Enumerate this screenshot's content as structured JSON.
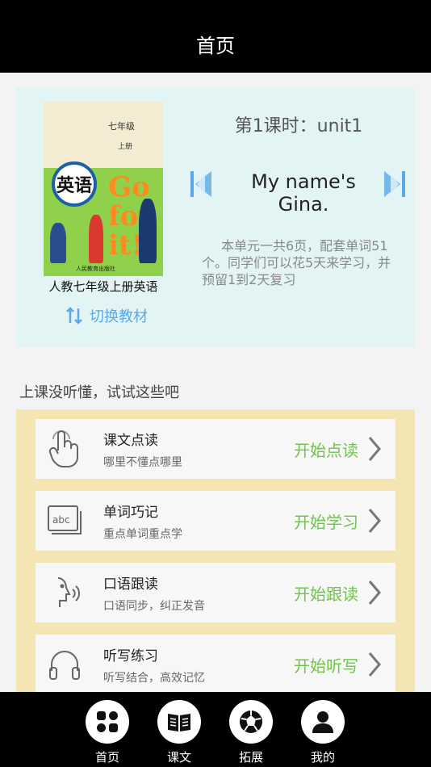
{
  "header": {
    "title": "首页"
  },
  "book": {
    "cover": {
      "grade": "七年级",
      "term": "上册",
      "badge": "英语",
      "go_text": "Go for it!",
      "publisher": "人民教育出版社"
    },
    "title": "人教七年级上册英语",
    "switch_label": "切换教材"
  },
  "lesson": {
    "title": "第1课时：unit1",
    "unit_name": "My name's Gina.",
    "description": "本单元一共6页，配套单词51个。同学们可以花5天来学习，并预留1到2天复习"
  },
  "section": {
    "title": "上课没听懂，试试这些吧"
  },
  "activities": [
    {
      "name": "课文点读",
      "subtitle": "哪里不懂点哪里",
      "action": "开始点读",
      "icon": "hand-pointer-icon"
    },
    {
      "name": "单词巧记",
      "subtitle": "重点单词重点学",
      "action": "开始学习",
      "icon": "abc-card-icon"
    },
    {
      "name": "口语跟读",
      "subtitle": "口语同步，纠正发音",
      "action": "开始跟读",
      "icon": "speaking-head-icon"
    },
    {
      "name": "听写练习",
      "subtitle": "听写结合，高效记忆",
      "action": "开始听写",
      "icon": "headphones-icon"
    }
  ],
  "tabs": [
    {
      "label": "首页",
      "icon": "grid-icon"
    },
    {
      "label": "课文",
      "icon": "book-icon"
    },
    {
      "label": "拓展",
      "icon": "ball-icon"
    },
    {
      "label": "我的",
      "icon": "user-icon"
    }
  ],
  "colors": {
    "accent_blue": "#5aa7ea",
    "accent_green": "#6fc44b",
    "panel_blue": "#e3f4f4",
    "panel_yellow": "#f3e6b2"
  }
}
